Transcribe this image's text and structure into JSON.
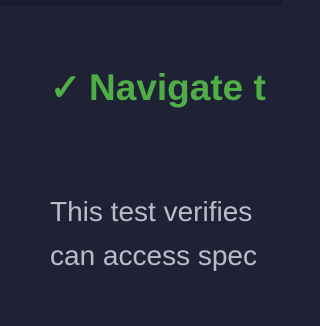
{
  "test": {
    "title": "Navigate t",
    "status_icon": "check-icon",
    "status_color": "#4fae46",
    "description_lines": [
      "This test verifies",
      "can access spec"
    ]
  }
}
